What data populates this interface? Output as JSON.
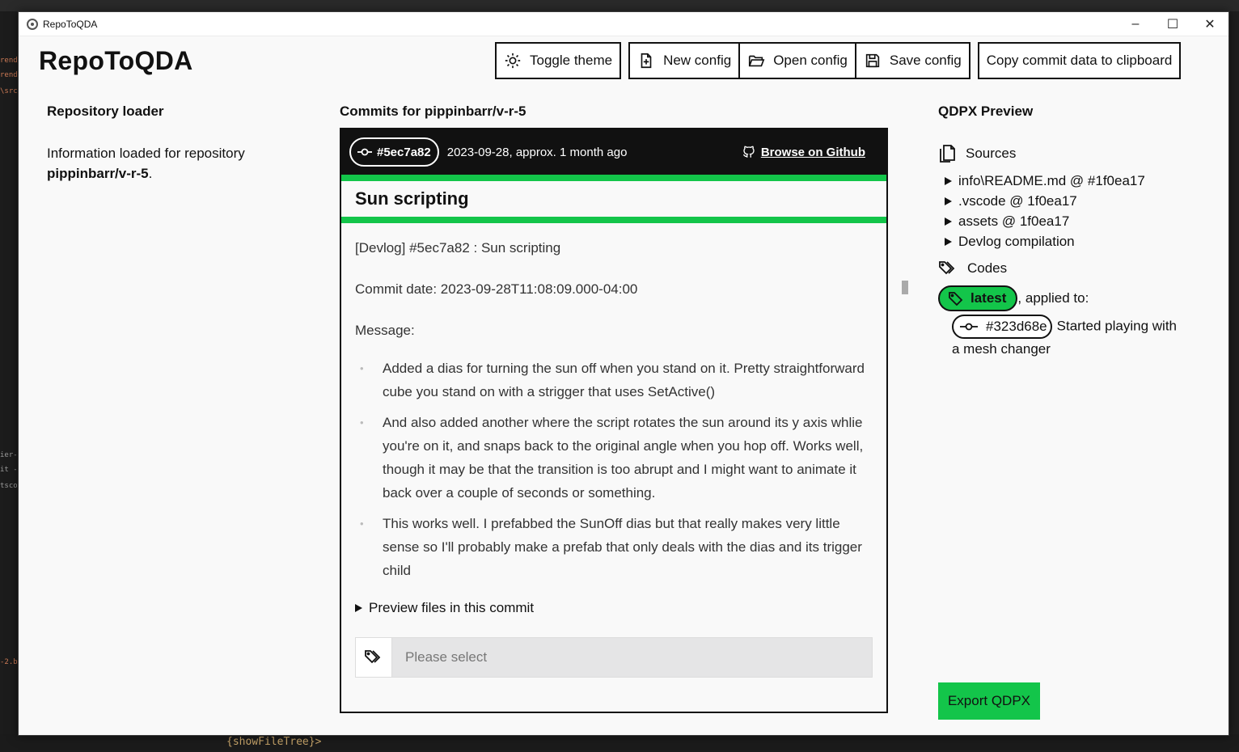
{
  "window": {
    "title": "RepoToQDA",
    "minimize": "–",
    "maximize": "☐",
    "close": "✕"
  },
  "app": {
    "heading": "RepoToQDA"
  },
  "toolbar": {
    "toggle_theme": "Toggle theme",
    "new_config": "New config",
    "open_config": "Open config",
    "save_config": "Save config",
    "copy_commit": "Copy commit data to clipboard"
  },
  "loader": {
    "title": "Repository loader",
    "text_prefix": "Information loaded for repository",
    "repo": "pippinbarr/v-r-5",
    "suffix": "."
  },
  "commits": {
    "title": "Commits for pippinbarr/v-r-5",
    "hash": "#5ec7a82",
    "date": "2023-09-28, approx. 1 month ago",
    "github_link": "Browse on Github",
    "commit_title": "Sun scripting",
    "line1": "[Devlog] #5ec7a82 : Sun scripting",
    "commit_date": "Commit date: 2023-09-28T11:08:09.000-04:00",
    "message_label": "Message:",
    "bullets": [
      "Added a dias for turning the sun off when you stand on it. Pretty straightforward cube you stand on with a strigger that uses SetActive()",
      "And also added another where the script rotates the sun around its y axis whlie you're on it, and snaps back to the original angle when you hop off. Works well, though it may be that the transition is too abrupt and I might want to animate it back over a couple of seconds or something.",
      "This works well. I prefabbed the SunOff dias but that really makes very little sense so I'll probably make a prefab that only deals with the dias and its trigger child"
    ],
    "preview_files": "Preview files in this commit",
    "code_select_placeholder": "Please select"
  },
  "qdpx": {
    "title": "QDPX Preview",
    "sources_label": "Sources",
    "sources": [
      "info\\README.md @ #1f0ea17",
      ".vscode @ 1f0ea17",
      "assets @ 1f0ea17",
      "Devlog compilation"
    ],
    "codes_label": "Codes",
    "code_name": "latest",
    "applied_to": ", applied to:",
    "applied_hash": "#323d68e",
    "applied_desc": "Started playing with a mesh changer",
    "export": "Export QDPX"
  },
  "background": {
    "editor_snippet": "{showFileTree}>"
  },
  "colors": {
    "accent_green": "#13c54a",
    "header_black": "#111111",
    "select_gray": "#e5e5e6"
  }
}
